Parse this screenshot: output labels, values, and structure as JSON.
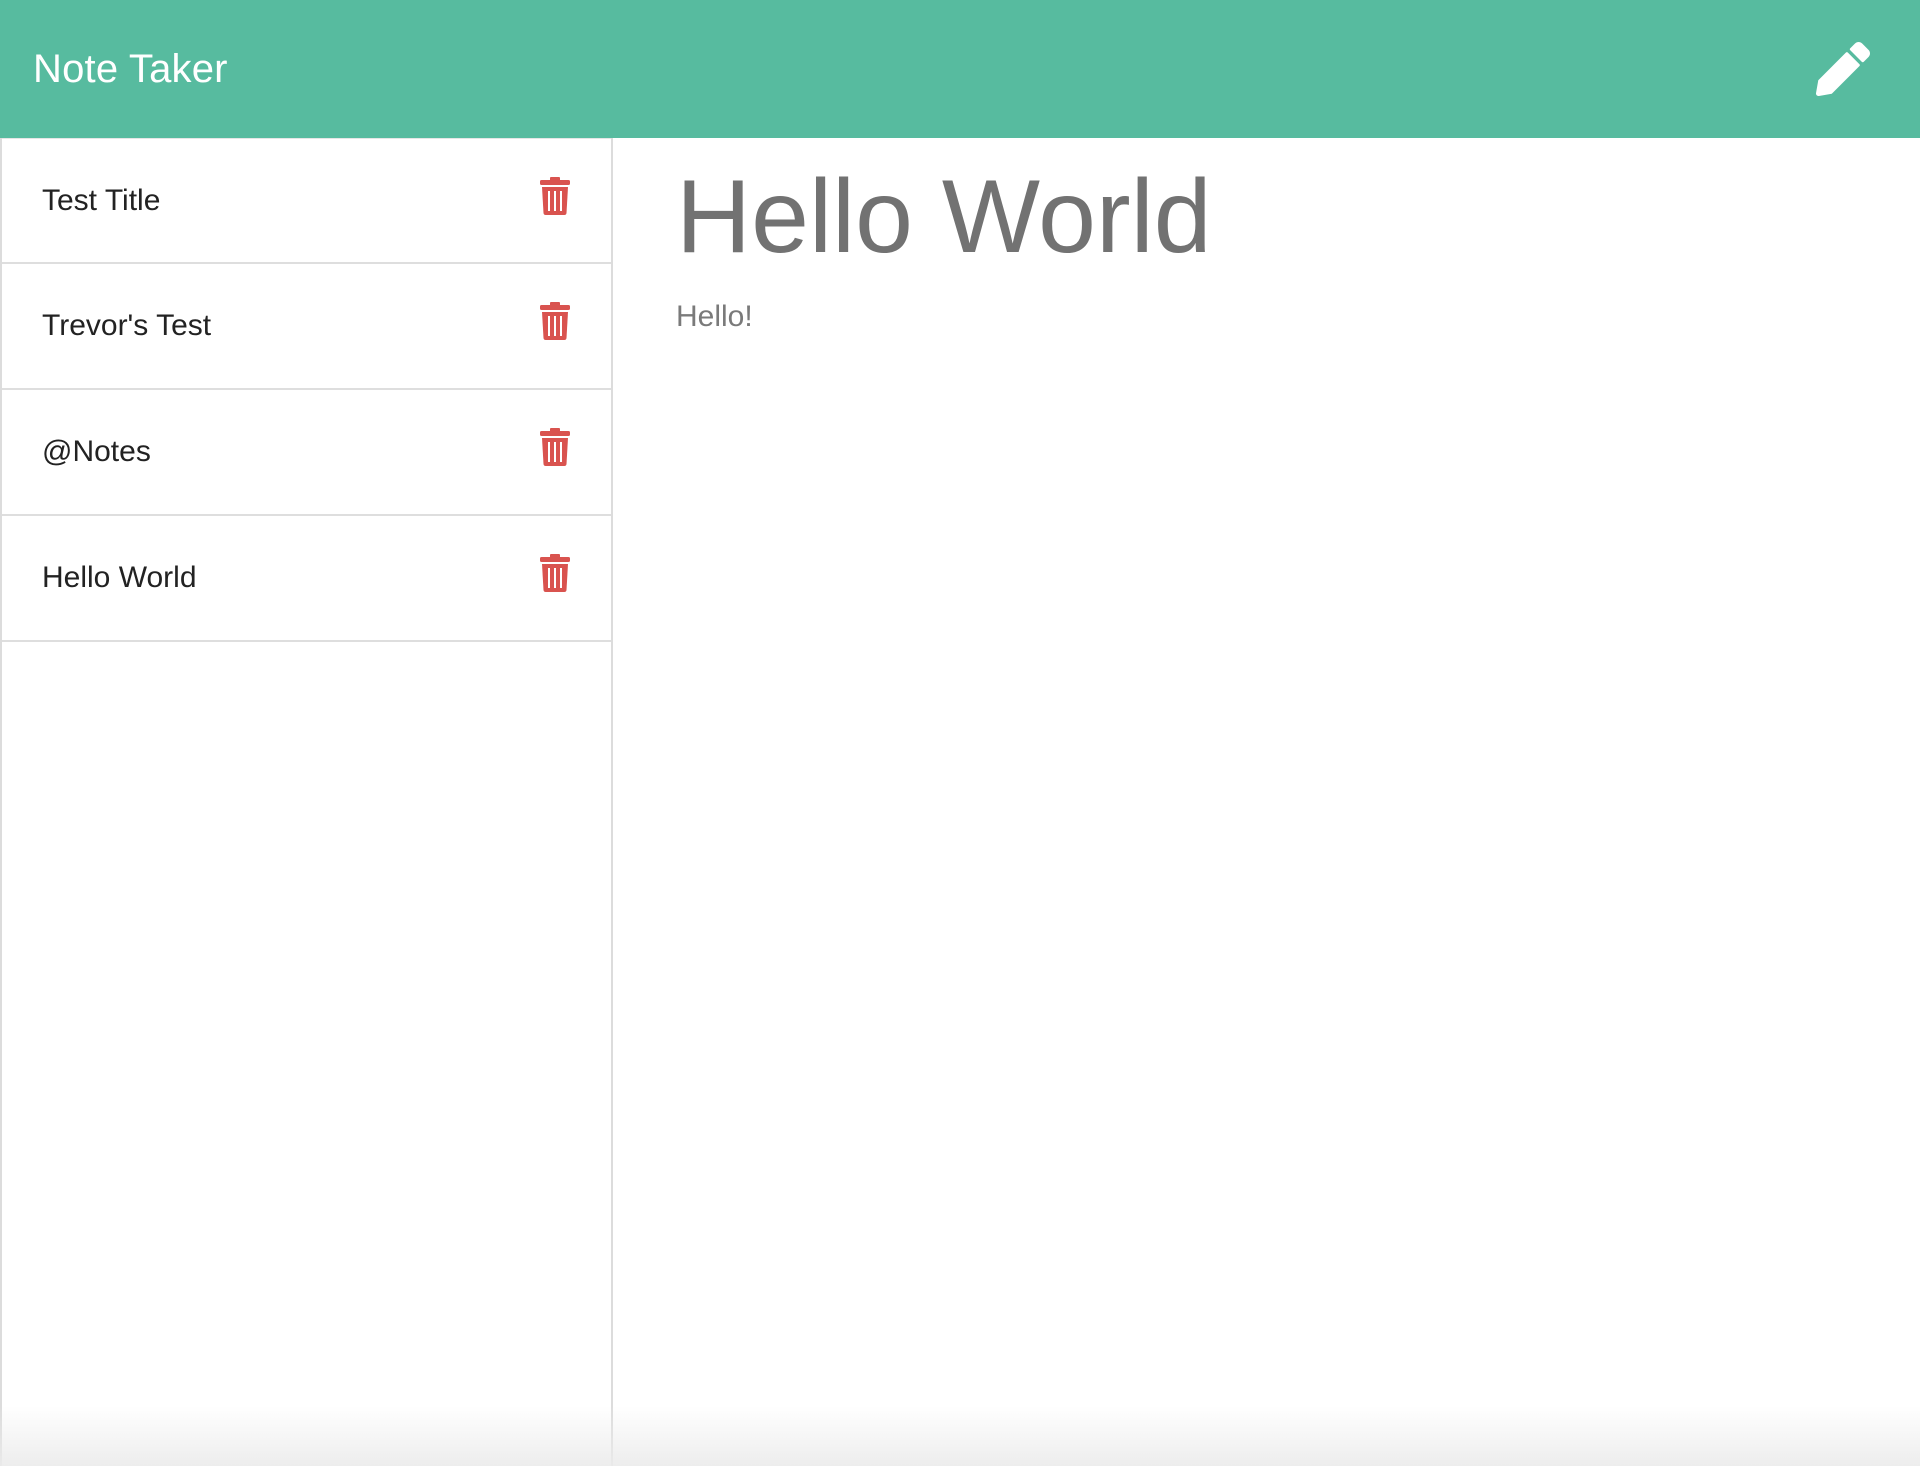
{
  "navbar": {
    "brand": "Note Taker",
    "new_note_icon": "pencil-icon",
    "background_color": "#57bb9f"
  },
  "sidebar": {
    "notes": [
      {
        "title": "Test Title",
        "delete_icon": "trash-icon"
      },
      {
        "title": "Trevor's Test",
        "delete_icon": "trash-icon"
      },
      {
        "title": "@Notes",
        "delete_icon": "trash-icon"
      },
      {
        "title": "Hello World",
        "delete_icon": "trash-icon"
      }
    ],
    "delete_icon_color": "#d9534f"
  },
  "main": {
    "note_title": "Hello World",
    "note_text": "Hello!"
  }
}
